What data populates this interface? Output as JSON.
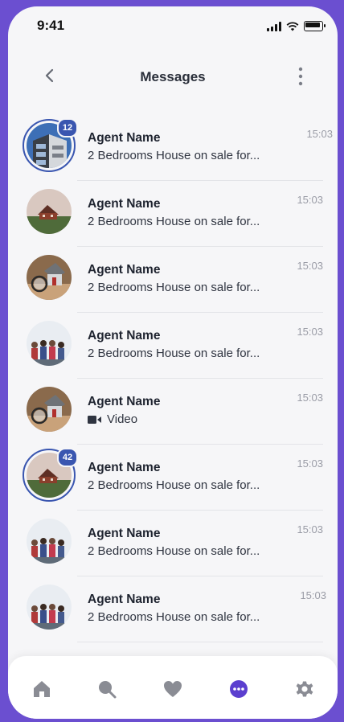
{
  "status": {
    "time": "9:41"
  },
  "header": {
    "title": "Messages"
  },
  "conversations": [
    {
      "name": "Agent Name",
      "preview": "2 Bedrooms House on sale for...",
      "time": "15:03",
      "badge": "12"
    },
    {
      "name": "Agent Name",
      "preview": "2 Bedrooms House on sale for...",
      "time": "15:03"
    },
    {
      "name": "Agent Name",
      "preview": "2 Bedrooms House on sale for...",
      "time": "15:03"
    },
    {
      "name": "Agent Name",
      "preview": "2 Bedrooms House on sale for...",
      "time": "15:03"
    },
    {
      "name": "Agent Name",
      "preview": "Video",
      "time": "15:03"
    },
    {
      "name": "Agent Name",
      "preview": "2 Bedrooms House on sale for...",
      "time": "15:03",
      "badge": "42"
    },
    {
      "name": "Agent Name",
      "preview": "2 Bedrooms House on sale for...",
      "time": "15:03"
    },
    {
      "name": "Agent Name",
      "preview": "2 Bedrooms House on sale for...",
      "time": "15:03"
    }
  ],
  "tabbar": {
    "items": [
      "home-icon",
      "search-icon",
      "heart-icon",
      "chat-icon",
      "gear-icon"
    ],
    "active": "chat-icon",
    "active_color": "#5b3fcf",
    "inactive_color": "#8a8c94"
  }
}
